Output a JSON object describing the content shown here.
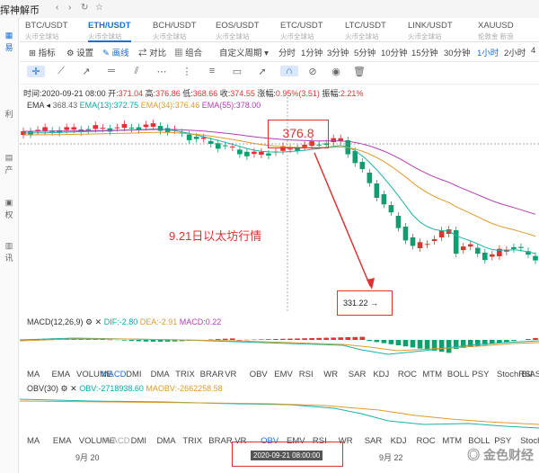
{
  "app": {
    "title": "挥神解币",
    "left_items": [
      "易",
      "利",
      "产",
      "权",
      "讯"
    ]
  },
  "pairs": [
    {
      "pair": "BTC/USDT",
      "sub": "火币全球站",
      "active": false
    },
    {
      "pair": "ETH/USDT",
      "sub": "火币全球站",
      "active": true
    },
    {
      "pair": "BCH/USDT",
      "sub": "火币全球站",
      "active": false
    },
    {
      "pair": "EOS/USDT",
      "sub": "火币全球站",
      "active": false
    },
    {
      "pair": "ETC/USDT",
      "sub": "火币全球站",
      "active": false
    },
    {
      "pair": "LTC/USDT",
      "sub": "火币全球站",
      "active": false
    },
    {
      "pair": "LINK/USDT",
      "sub": "火币全球站",
      "active": false
    },
    {
      "pair": "XAUUSD",
      "sub": "伦敦金 新浪",
      "active": false
    }
  ],
  "toolbar": {
    "indicator": "指标",
    "settings": "设置",
    "draw": "画线",
    "compare": "对比",
    "combo": "组合",
    "custom_period": "自定义周期",
    "periods": [
      "分时",
      "1分钟",
      "3分钟",
      "5分钟",
      "10分钟",
      "15分钟",
      "30分钟",
      "1小时",
      "2小时",
      "4"
    ],
    "active_period": "1小时"
  },
  "info": {
    "time_label": "时间:",
    "time": "2020-09-21 08:00",
    "open_label": "开:",
    "open": "371.04",
    "high_label": "高:",
    "high": "376.86",
    "low_label": "低:",
    "low": "368.66",
    "close_label": "收:",
    "close": "374.55",
    "change_label": "涨幅:",
    "change": "0.95%(3.51)",
    "amp_label": "振幅:",
    "amp": "2.21%"
  },
  "ema": {
    "label": "EMA",
    "ema5": "368.43",
    "ema13": "EMA(13):372.75",
    "ema34": "EMA(34):376.46",
    "ema55": "EMA(55):378.00"
  },
  "annotations": {
    "high_price": "376.8",
    "low_price": "331.22",
    "note": "9.21日以太坊行情"
  },
  "macd": {
    "label": "MACD(12,26,9)",
    "dif": "DIF:-2.80",
    "dea": "DEA:-2.91",
    "macd": "MACD:0.22"
  },
  "obv": {
    "label": "OBV(30)",
    "obv": "OBV:-2718938.60",
    "maobv": "MAOBV:-2662258.58"
  },
  "indicators_row1": [
    "MA",
    "EMA",
    "VOLUME",
    "MACD",
    "DMI",
    "DMA",
    "TRIX",
    "BRAR",
    "VR",
    "OBV",
    "EMV",
    "RSI",
    "WR",
    "SAR",
    "KDJ",
    "ROC",
    "MTM",
    "BOLL",
    "PSY",
    "StochRSI",
    "BIAS"
  ],
  "indicators_row2": [
    "MA",
    "EMA",
    "VOLUME",
    "MACD",
    "DMI",
    "DMA",
    "TRIX",
    "BRAR",
    "VR",
    "OBV",
    "EMV",
    "RSI",
    "WR",
    "SAR",
    "KDJ",
    "ROC",
    "MTM",
    "BOLL",
    "PSY",
    "StochRSI"
  ],
  "date_axis": {
    "d1": "9月 20",
    "d2": "9月 22",
    "cursor": "2020-09-21 08:00:00"
  },
  "watermark": "金色财经",
  "colors": {
    "up": "#e03232",
    "down": "#0aa170",
    "accent": "#1a6fd6",
    "ema13": "#19b3a6",
    "ema34": "#e09a2a",
    "ema55": "#b23db2"
  }
}
